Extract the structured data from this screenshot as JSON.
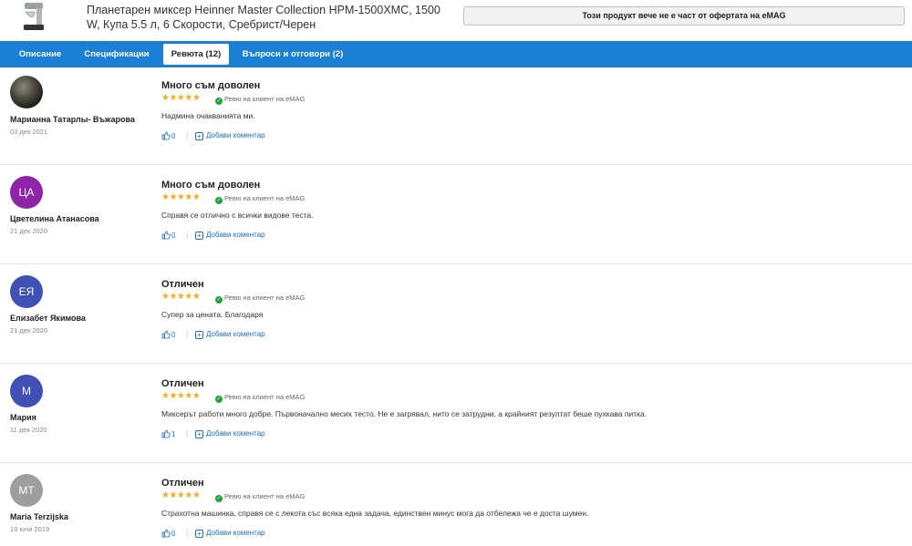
{
  "product": {
    "title": "Планетарен миксер Heinner Master Collection HPM-1500XMC, 1500 W, Купа 5.5 л, 6 Скорости, Сребрист/Черен",
    "availability_notice": "Този продукт вече не е част от офертата на eMAG"
  },
  "tabs": [
    {
      "label": "Описание",
      "active": false
    },
    {
      "label": "Спецификации",
      "active": false
    },
    {
      "label": "Ревюта (12)",
      "active": true
    },
    {
      "label": "Въпроси и отговори (2)",
      "active": false
    }
  ],
  "review_meta": {
    "verified_label": "Ревю на клиент на eMAG",
    "add_comment_label": "Добави коментар",
    "stars": "★★★★★"
  },
  "colors": {
    "tab_bar": "#1a7fd5",
    "star": "#f2b01e",
    "verified_check": "#1fa33a",
    "link": "#1a6fc2"
  },
  "reviews": [
    {
      "initials": "",
      "avatar_type": "photo",
      "author": "Марианна Татарлы- Въжарова",
      "date": "03 дек 2021",
      "title": "Много съм доволен",
      "rating": 5,
      "text": "Надмина очакванията ми.",
      "likes": "0"
    },
    {
      "initials": "ЦА",
      "avatar_color": "#8e24aa",
      "author": "Цветелина Атанасова",
      "date": "21 дек 2020",
      "title": "Много съм доволен",
      "rating": 5,
      "text": "Справя се отлично с всички видове теста.",
      "likes": "0"
    },
    {
      "initials": "ЕЯ",
      "avatar_color": "#3f51b5",
      "author": "Елизабет Якимова",
      "date": "21 дек 2020",
      "title": "Отличен",
      "rating": 5,
      "text": "Супер за цената. Благодаря",
      "likes": "0"
    },
    {
      "initials": "М",
      "avatar_color": "#3f51b5",
      "author": "Мария",
      "date": "11 дек 2020",
      "title": "Отличен",
      "rating": 5,
      "text": "Миксерът работи много добре. Първоначално месих тесто. Не е загрявал, нито се затрудни, а крайният резултат беше пухкава питка.",
      "likes": "1"
    },
    {
      "initials": "MT",
      "avatar_color": "#9e9e9e",
      "author": "Maria Terzijska",
      "date": "19 юни 2019",
      "title": "Отличен",
      "rating": 5,
      "text": "Страхотна машинка, справя се с лекота със всяка една задача, единствен минус мога да отбележа че е доста шумен.",
      "likes": "0"
    }
  ]
}
